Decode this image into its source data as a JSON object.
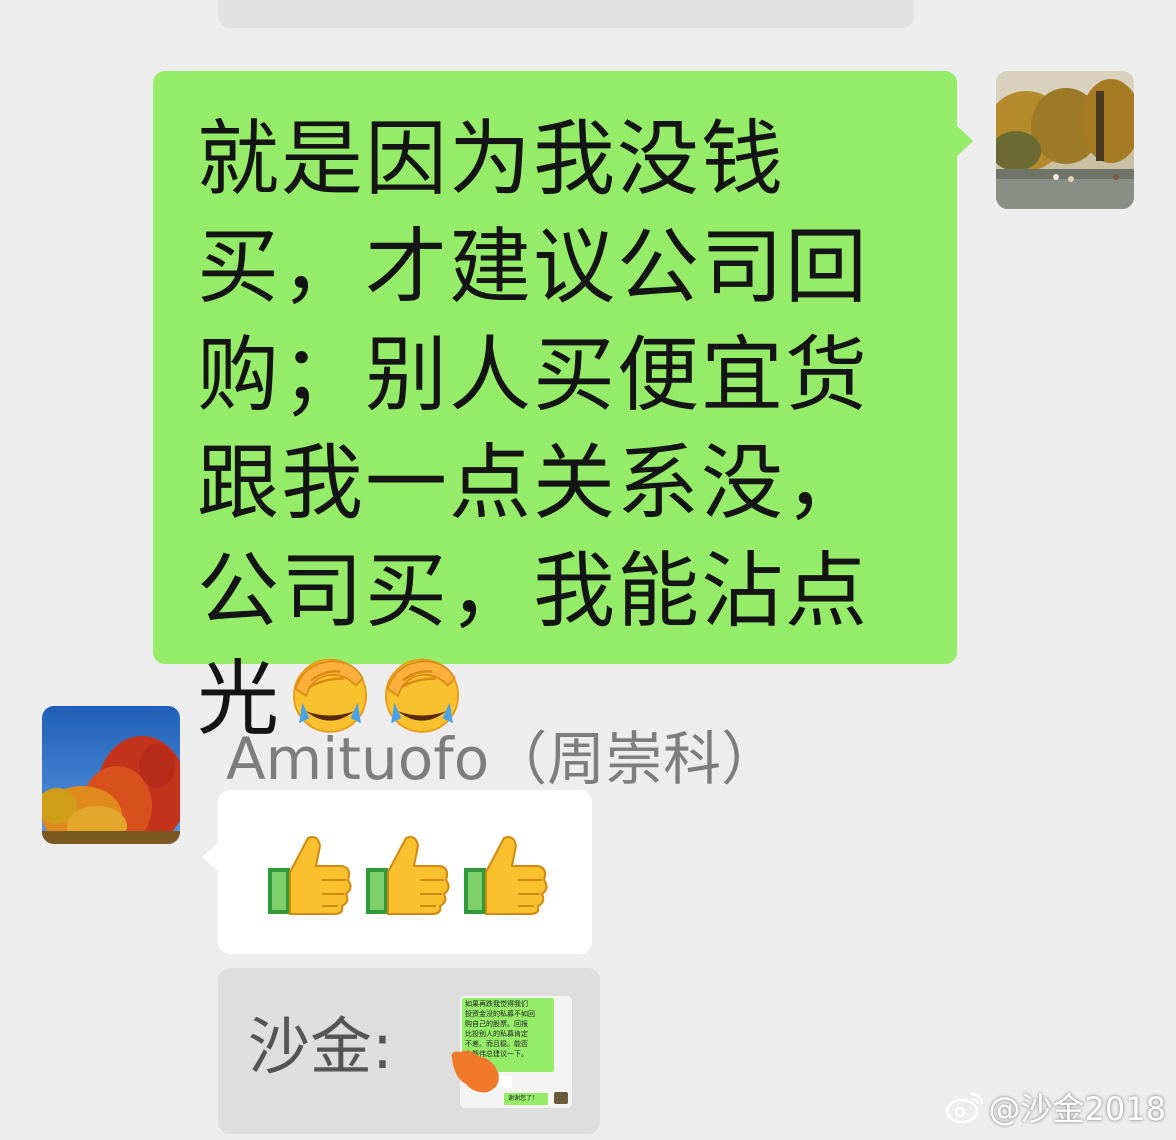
{
  "chat": {
    "outgoing_message": {
      "text": "就是因为我没钱买，才建议公司回购；别人买便宜货跟我一点关系没，公司买，我能沾点光",
      "emojis": [
        "facepalm-laugh-emoji",
        "facepalm-laugh-emoji"
      ]
    },
    "incoming": {
      "sender_name": "Amituofo（周崇科）",
      "message_emojis": [
        "thumbs-up-emoji",
        "thumbs-up-emoji",
        "thumbs-up-emoji"
      ],
      "quote": {
        "label": "沙金:",
        "thumb_lines": [
          "如果再跌我觉得我们",
          "投资金没的私募不如回",
          "购自己的股票。回报",
          "比投别人的私募肯定",
          "不差。而且稳。能否",
          "向熊伟总建议一下。",
          "🙏🙏"
        ],
        "thumb_reply": "熊总👍",
        "thumb_thanks": "谢谢您了！"
      }
    }
  },
  "watermark": {
    "text": "@沙金2018"
  },
  "colors": {
    "background": "#ededed",
    "outgoing_bubble": "#95ec69",
    "incoming_bubble": "#ffffff",
    "quote_box": "#dedede",
    "sender_name": "#7d7d7d"
  }
}
